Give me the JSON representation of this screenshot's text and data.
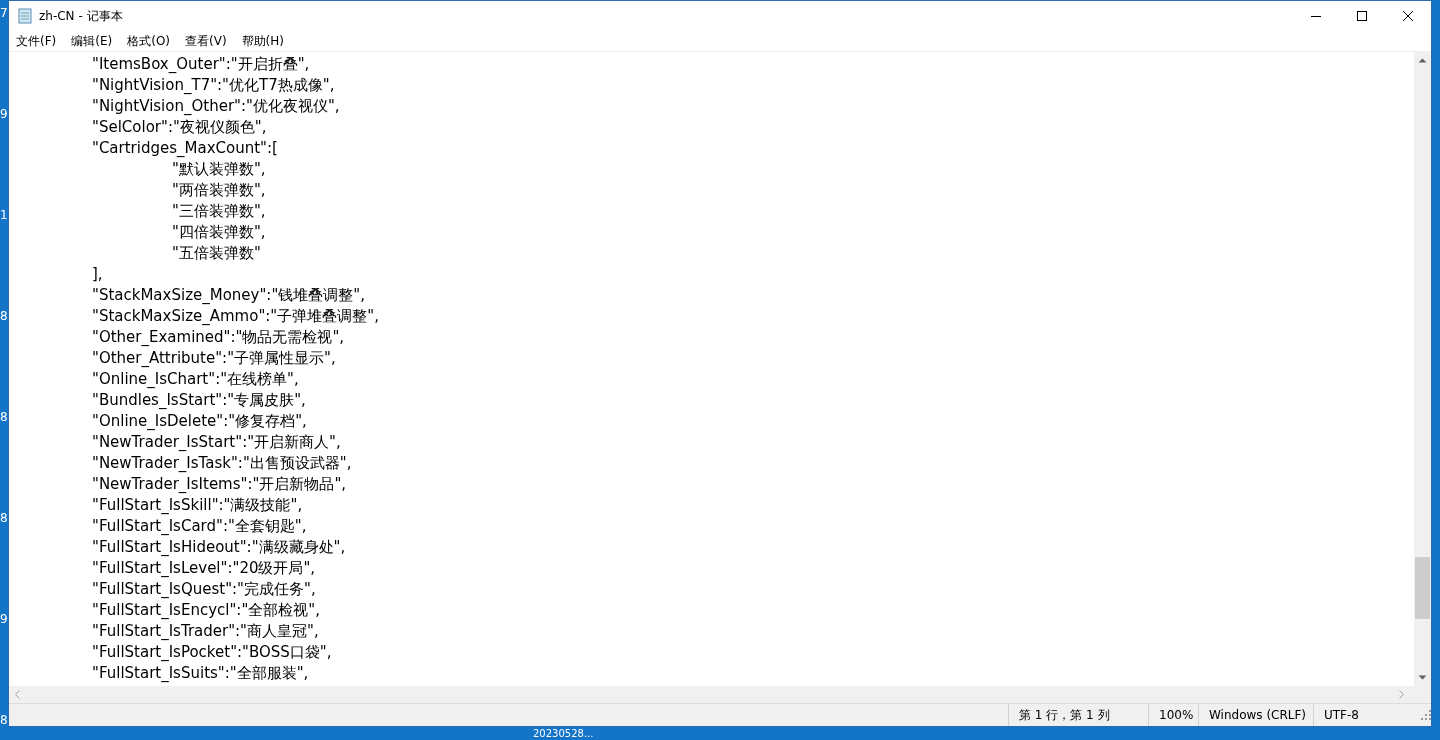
{
  "desktop": {
    "edge_digits": [
      "7",
      "9",
      "1",
      "8",
      "8",
      "8",
      "9",
      "8"
    ],
    "icon_label": "20230528..."
  },
  "window": {
    "title": "zh-CN - 记事本"
  },
  "menu": [
    "文件(F)",
    "编辑(E)",
    "格式(O)",
    "查看(V)",
    "帮助(H)"
  ],
  "editor": {
    "lines": [
      "\t\t\"ItemsBox_Outer\":\"开启折叠\",",
      "\t\t\"NightVision_T7\":\"优化T7热成像\",",
      "\t\t\"NightVision_Other\":\"优化夜视仪\",",
      "\t\t\"SelColor\":\"夜视仪颜色\",",
      "\t\t\"Cartridges_MaxCount\":[",
      "\t\t\t\t\"默认装弹数\",",
      "\t\t\t\t\"两倍装弹数\",",
      "\t\t\t\t\"三倍装弹数\",",
      "\t\t\t\t\"四倍装弹数\",",
      "\t\t\t\t\"五倍装弹数\"",
      "\t\t],",
      "\t\t\"StackMaxSize_Money\":\"钱堆叠调整\",",
      "\t\t\"StackMaxSize_Ammo\":\"子弹堆叠调整\",",
      "\t\t\"Other_Examined\":\"物品无需检视\",",
      "\t\t\"Other_Attribute\":\"子弹属性显示\",",
      "\t\t\"Online_IsChart\":\"在线榜单\",",
      "\t\t\"Bundles_IsStart\":\"专属皮肤\",",
      "\t\t\"Online_IsDelete\":\"修复存档\",",
      "\t\t\"NewTrader_IsStart\":\"开启新商人\",",
      "\t\t\"NewTrader_IsTask\":\"出售预设武器\",",
      "\t\t\"NewTrader_IsItems\":\"开启新物品\",",
      "\t\t\"FullStart_IsSkill\":\"满级技能\",",
      "\t\t\"FullStart_IsCard\":\"全套钥匙\",",
      "\t\t\"FullStart_IsHideout\":\"满级藏身处\",",
      "\t\t\"FullStart_IsLevel\":\"20级开局\",",
      "\t\t\"FullStart_IsQuest\":\"完成任务\",",
      "\t\t\"FullStart_IsEncycl\":\"全部检视\",",
      "\t\t\"FullStart_IsTrader\":\"商人皇冠\",",
      "\t\t\"FullStart_IsPocket\":\"BOSS口袋\",",
      "\t\t\"FullStart_IsSuits\":\"全部服装\","
    ]
  },
  "status_bar": [
    "第 1 行，第 1 列",
    "100%",
    "Windows (CRLF)",
    "UTF-8"
  ]
}
